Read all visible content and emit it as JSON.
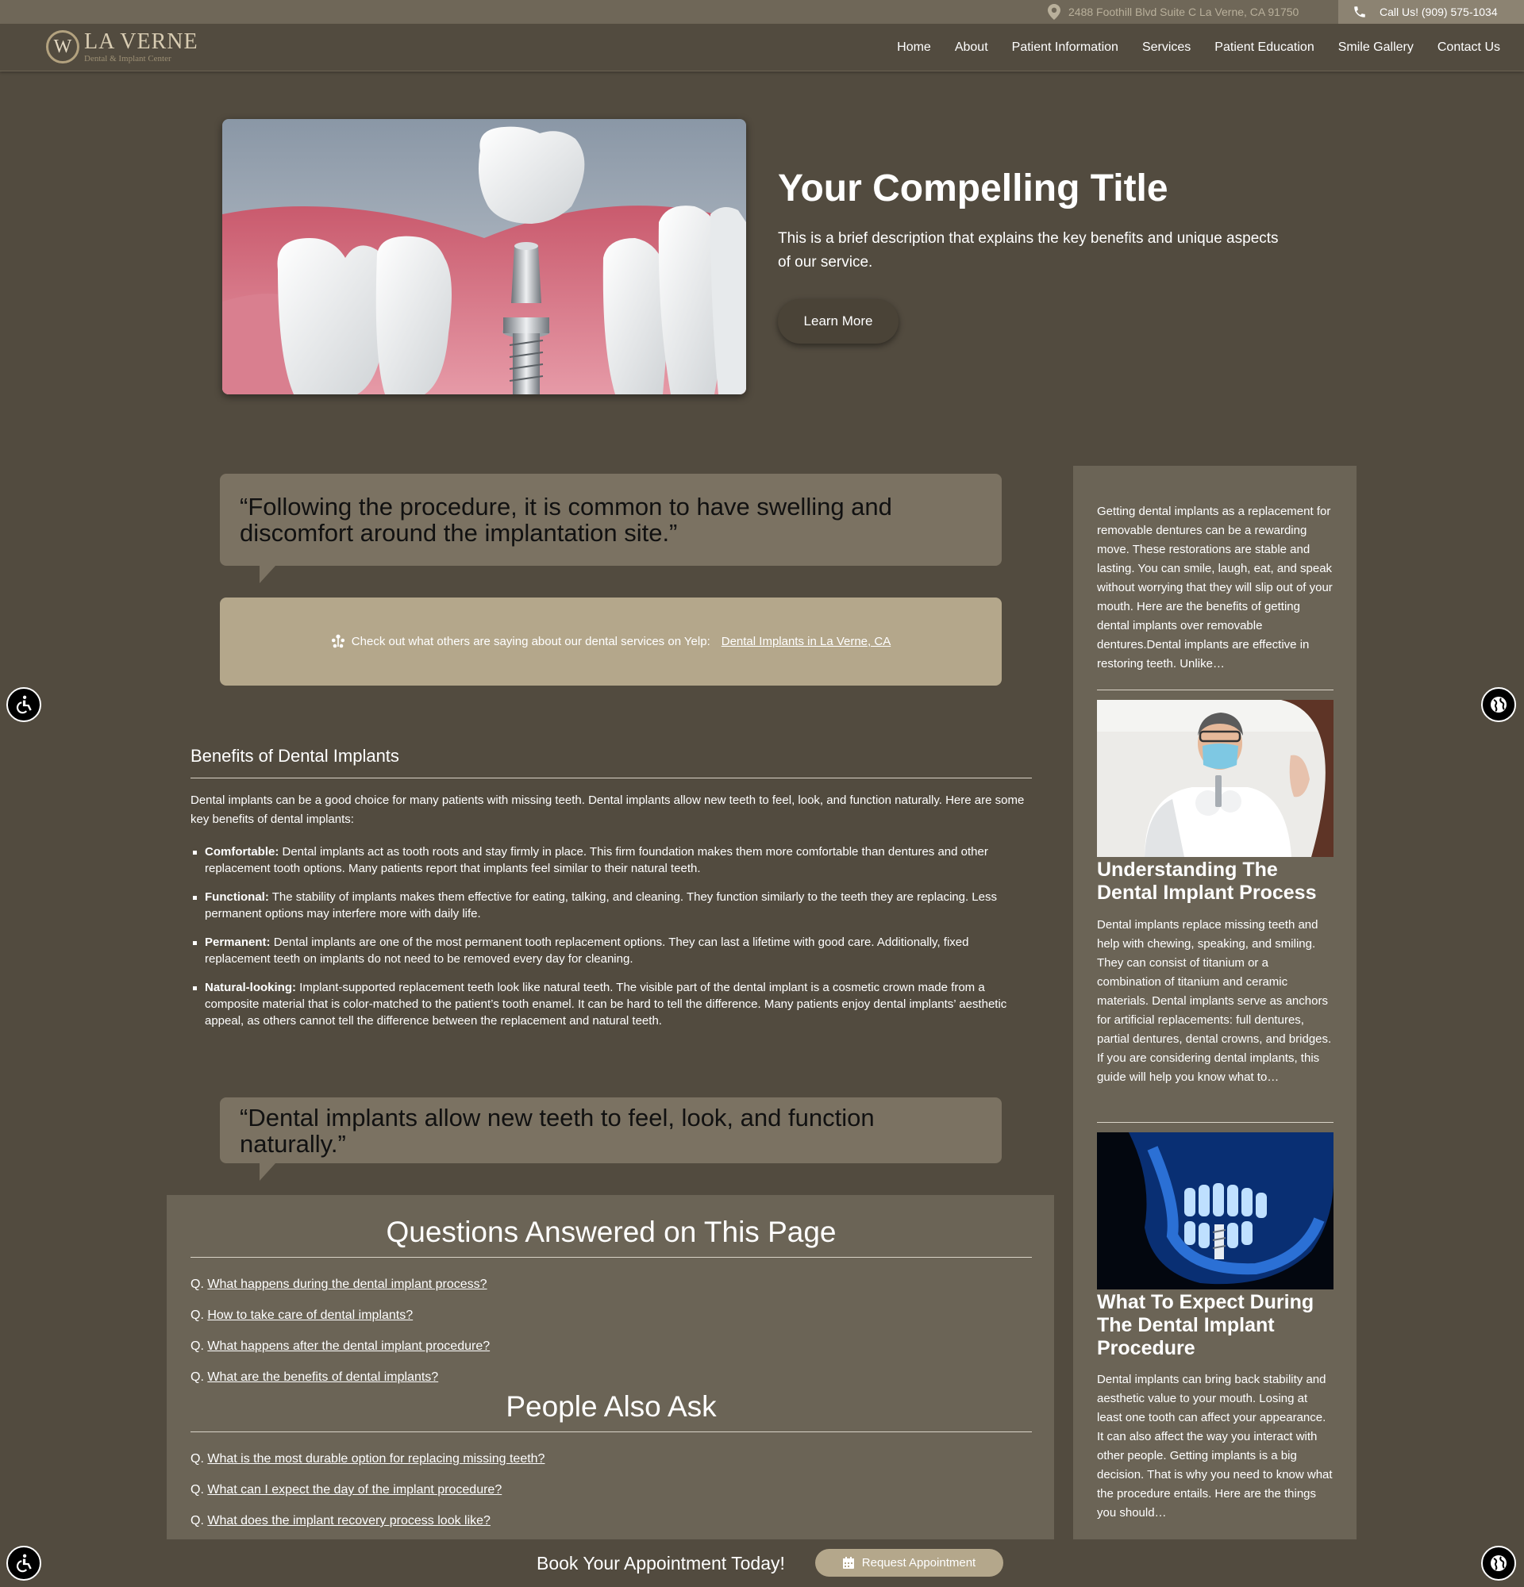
{
  "topbar": {
    "address": "2488 Foothill Blvd Suite C La Verne, CA 91750",
    "call_label": "Call Us! (909) 575-1034"
  },
  "logo": {
    "mark": "W",
    "name": "LA VERNE",
    "subtitle": "Dental & Implant Center"
  },
  "nav": {
    "items": [
      "Home",
      "About",
      "Patient Information",
      "Services",
      "Patient Education",
      "Smile Gallery",
      "Contact Us"
    ]
  },
  "hero": {
    "title": "Your Compelling Title",
    "description": "This is a brief description that explains the key benefits and unique aspects of our service.",
    "button_label": "Learn More"
  },
  "quotes": {
    "first": "“Following the procedure, it is common to have swelling and discomfort around the implantation site.”",
    "second": "“Dental implants allow new teeth to feel, look, and function naturally.”"
  },
  "yelp": {
    "text": "Check out what others are saying about our dental services on Yelp:",
    "link": "Dental Implants in La Verne, CA"
  },
  "benefits": {
    "heading": "Benefits of Dental Implants",
    "intro": "Dental implants can be a good choice for many patients with missing teeth. Dental implants allow new teeth to feel, look, and function naturally. Here are some key benefits of dental implants:",
    "items": [
      {
        "term": "Comfortable:",
        "text": " Dental implants act as tooth roots and stay firmly in place. This firm foundation makes them more comfortable than dentures and other replacement tooth options. Many patients report that implants feel similar to their natural teeth."
      },
      {
        "term": "Functional:",
        "text": " The stability of implants makes them effective for eating, talking, and cleaning. They function similarly to the teeth they are replacing. Less permanent options may interfere more with daily life."
      },
      {
        "term": "Permanent:",
        "text": " Dental implants are one of the most permanent tooth replacement options. They can last a lifetime with good care. Additionally, fixed replacement teeth on implants do not need to be removed every day for cleaning."
      },
      {
        "term": "Natural-looking:",
        "text": " Implant-supported replacement teeth look like natural teeth. The visible part of the dental implant is a cosmetic crown made from a composite material that is color-matched to the patient’s tooth enamel. It can be hard to tell the difference. Many patients enjoy dental implants’ aesthetic appeal, as others cannot tell the difference between the replacement and natural teeth."
      }
    ]
  },
  "questions": {
    "heading": "Questions Answered on This Page",
    "prefix": "Q.",
    "items": [
      "What happens during the dental implant process?",
      "How to take care of dental implants?",
      "What happens after the dental implant procedure?",
      "What are the benefits of dental implants?"
    ]
  },
  "people_ask": {
    "heading": "People Also Ask",
    "prefix": "Q.",
    "items": [
      "What is the most durable option for replacing missing teeth?",
      "What can I expect the day of the implant procedure?",
      "What does the implant recovery process look like?"
    ]
  },
  "sidebar": {
    "intro": "Getting dental implants as a replacement for removable dentures can be a rewarding move. These restorations are stable and lasting. You can smile, laugh, eat, and speak without worrying that they will slip out of your mouth. Here are the benefits of getting dental implants over removable dentures.Dental implants are effective in restoring teeth. Unlike…",
    "articles": [
      {
        "title": "Understanding The Dental Implant Process",
        "text": "Dental implants replace missing teeth and help with chewing, speaking, and smiling. They can consist of titanium or a combination of titanium and ceramic materials. Dental implants serve as anchors for artificial replacements: full dentures, partial dentures, dental crowns, and bridges. If you are considering dental implants, this guide will help you know what to…"
      },
      {
        "title": "What To Expect During The Dental Implant Procedure",
        "text": "Dental implants can bring back stability and aesthetic value to your mouth. Losing at least one tooth can affect your appearance. It can also affect the way you interact with other people. Getting implants is a big decision. That is why you need to know what the procedure entails. Here are the things you should…"
      }
    ]
  },
  "bottom": {
    "book_text": "Book Your Appointment Today!",
    "button_label": "Request Appointment"
  },
  "colors": {
    "background": "#524b3f",
    "panel": "#6b6456",
    "quote": "#7b7262",
    "accent": "#b4a78b"
  },
  "icons": [
    "location-pin-icon",
    "phone-icon",
    "yelp-icon",
    "calendar-icon",
    "accessibility-icon",
    "globe-icon"
  ]
}
